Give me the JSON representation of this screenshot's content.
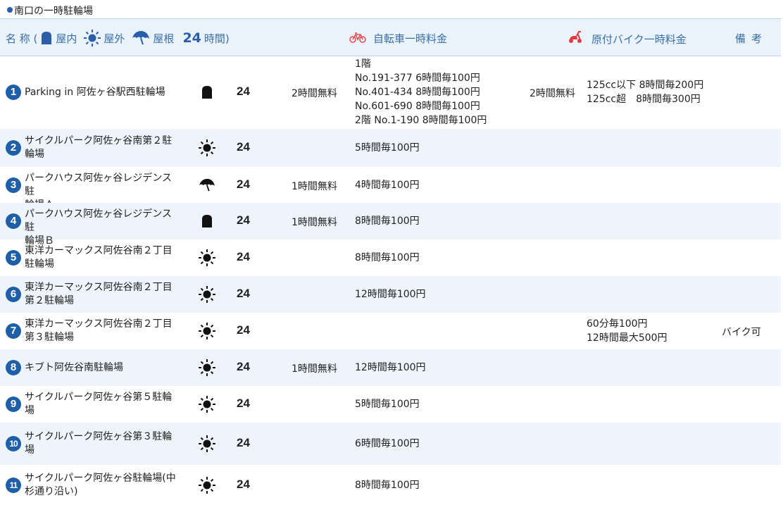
{
  "page": {
    "title": "南口の一時駐輪場"
  },
  "header": {
    "name_label": "名 称 (",
    "indoor_label": "屋内",
    "outdoor_label": "屋外",
    "roof_label": "屋根",
    "h24": "24",
    "hours_label": "時間)",
    "bike_fee": "自転車一時料金",
    "moto_fee": "原付バイク一時料金",
    "note": "備考"
  },
  "rows": [
    {
      "num": "1",
      "name": [
        "Parking in 阿佐ヶ谷駅西駐輪場"
      ],
      "type": "indoor-icon",
      "h24": "24",
      "bike_free": "2時間無料",
      "bike_fee": [
        "1階",
        "No.191-377 6時間毎100円",
        "No.401-434 8時間毎100円",
        "No.601-690 8時間毎100円",
        "2階 No.1-190 8時間毎100円"
      ],
      "moto_free": "2時間無料",
      "moto_fee": [
        "125cc以下 8時間毎200円",
        "125cc超　8時間毎300円"
      ],
      "note": ""
    },
    {
      "num": "2",
      "name": [
        "サイクルパーク阿佐ヶ谷南第２駐",
        "輪場"
      ],
      "type": "sun-icon",
      "h24": "24",
      "bike_free": "",
      "bike_fee": [
        "5時間毎100円"
      ],
      "moto_free": "",
      "moto_fee": [],
      "note": ""
    },
    {
      "num": "3",
      "name": [
        "パークハウス阿佐ヶ谷レジデンス駐",
        "輪場Ａ"
      ],
      "type": "umbrella-icon",
      "h24": "24",
      "bike_free": "1時間無料",
      "bike_fee": [
        "4時間毎100円"
      ],
      "moto_free": "",
      "moto_fee": [],
      "note": ""
    },
    {
      "num": "4",
      "name": [
        "パークハウス阿佐ヶ谷レジデンス駐",
        "輪場Ｂ"
      ],
      "type": "indoor-icon",
      "h24": "24",
      "bike_free": "1時間無料",
      "bike_fee": [
        "8時間毎100円"
      ],
      "moto_free": "",
      "moto_fee": [],
      "note": ""
    },
    {
      "num": "5",
      "name": [
        "東洋カーマックス阿佐谷南２丁目",
        "駐輪場"
      ],
      "type": "sun-icon",
      "h24": "24",
      "bike_free": "",
      "bike_fee": [
        "8時間毎100円"
      ],
      "moto_free": "",
      "moto_fee": [],
      "note": ""
    },
    {
      "num": "6",
      "name": [
        "東洋カーマックス阿佐谷南２丁目",
        "第２駐輪場"
      ],
      "type": "sun-icon",
      "h24": "24",
      "bike_free": "",
      "bike_fee": [
        "12時間毎100円"
      ],
      "moto_free": "",
      "moto_fee": [],
      "note": ""
    },
    {
      "num": "7",
      "name": [
        "東洋カーマックス阿佐谷南２丁目",
        "第３駐輪場"
      ],
      "type": "sun-icon",
      "h24": "24",
      "bike_free": "",
      "bike_fee": [],
      "moto_free": "",
      "moto_fee": [
        "60分毎100円",
        "12時間最大500円"
      ],
      "note": "バイク可"
    },
    {
      "num": "8",
      "name": [
        "キブト阿佐谷南駐輪場"
      ],
      "type": "sun-icon",
      "h24": "24",
      "bike_free": "1時間無料",
      "bike_fee": [
        "12時間毎100円"
      ],
      "moto_free": "",
      "moto_fee": [],
      "note": ""
    },
    {
      "num": "9",
      "name": [
        "サイクルパーク阿佐ヶ谷第５駐輪",
        "場"
      ],
      "type": "sun-icon",
      "h24": "24",
      "bike_free": "",
      "bike_fee": [
        "5時間毎100円"
      ],
      "moto_free": "",
      "moto_fee": [],
      "note": ""
    },
    {
      "num": "10",
      "name": [
        "サイクルパーク阿佐ヶ谷第３駐輪",
        "場"
      ],
      "type": "sun-icon",
      "h24": "24",
      "bike_free": "",
      "bike_fee": [
        "6時間毎100円"
      ],
      "moto_free": "",
      "moto_fee": [],
      "note": ""
    },
    {
      "num": "11",
      "name": [
        "サイクルパーク阿佐ヶ谷駐輪場(中",
        "杉通り沿い)"
      ],
      "type": "sun-icon",
      "h24": "24",
      "bike_free": "",
      "bike_fee": [
        "8時間毎100円"
      ],
      "moto_free": "",
      "moto_fee": [],
      "note": ""
    }
  ],
  "colors": {
    "accent": "#2a5ea8",
    "header_bg": "#eaf3fb",
    "alt_row": "#edf4fb",
    "moto_icon": "#e23b3b",
    "bike_icon": "#e05050"
  }
}
